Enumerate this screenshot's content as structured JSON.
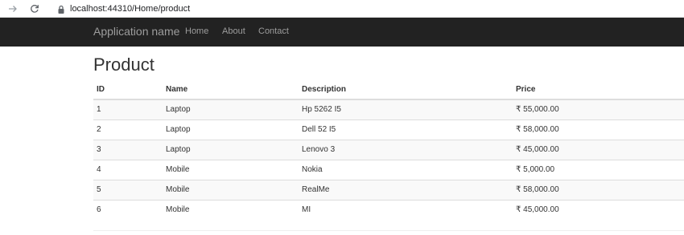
{
  "browser": {
    "url": "localhost:44310/Home/product"
  },
  "navbar": {
    "brand": "Application name",
    "links": [
      "Home",
      "About",
      "Contact"
    ]
  },
  "page": {
    "title": "Product"
  },
  "table": {
    "headers": [
      "ID",
      "Name",
      "Description",
      "Price"
    ],
    "rows": [
      [
        "1",
        "Laptop",
        "Hp 5262 I5",
        "₹ 55,000.00"
      ],
      [
        "2",
        "Laptop",
        "Dell 52 I5",
        "₹ 58,000.00"
      ],
      [
        "3",
        "Laptop",
        "Lenovo 3",
        "₹ 45,000.00"
      ],
      [
        "4",
        "Mobile",
        "Nokia",
        "₹ 5,000.00"
      ],
      [
        "5",
        "Mobile",
        "RealMe",
        "₹ 58,000.00"
      ],
      [
        "6",
        "Mobile",
        "MI",
        "₹ 45,000.00"
      ]
    ]
  },
  "colors": {
    "navbar_bg": "#222222",
    "nav_text": "#9d9d9d",
    "stripe": "#f9f9f9"
  }
}
